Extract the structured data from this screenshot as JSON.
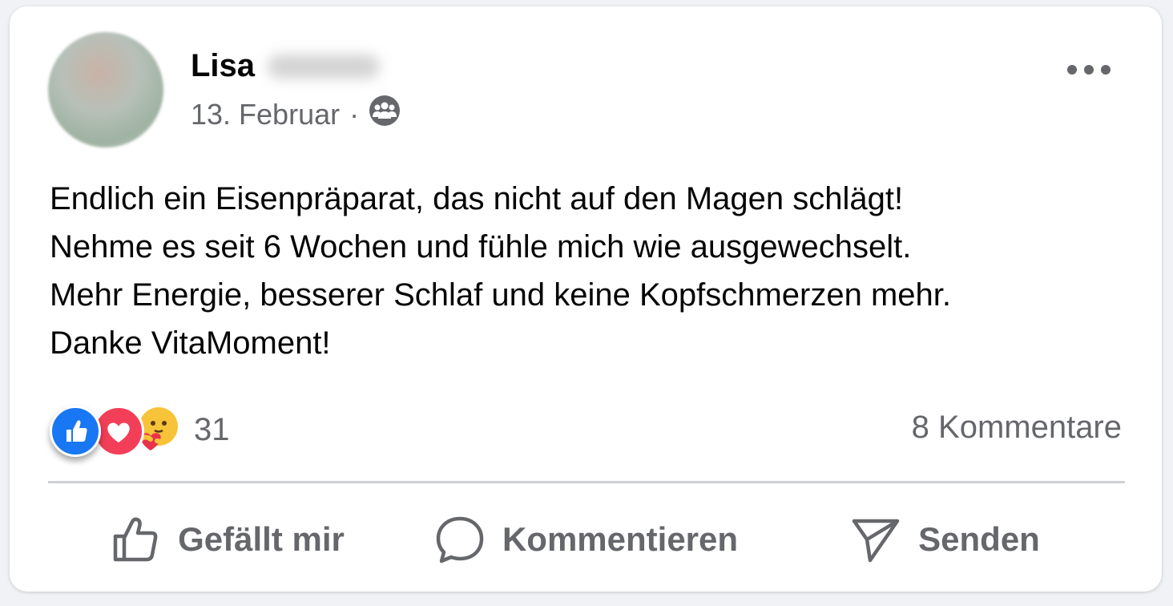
{
  "post": {
    "author_first_name": "Lisa",
    "date": "13. Februar",
    "separator": "·",
    "audience_icon": "group-icon",
    "text_lines": [
      "Endlich ein Eisenpräparat, das nicht auf den Magen schlägt!",
      "Nehme es seit 6 Wochen und fühle mich wie ausgewechselt.",
      "Mehr Energie, besserer Schlaf und keine Kopfschmerzen mehr.",
      "Danke VitaMoment!"
    ]
  },
  "reactions": {
    "types": [
      "like-icon",
      "love-icon",
      "care-icon"
    ],
    "count": "31"
  },
  "comments_count_label": "8 Kommentare",
  "actions": {
    "like_label": "Gefällt mir",
    "comment_label": "Kommentieren",
    "send_label": "Senden"
  },
  "colors": {
    "like_blue": "#1877f2",
    "love_red": "#f33e58",
    "secondary_text": "#65676b"
  }
}
